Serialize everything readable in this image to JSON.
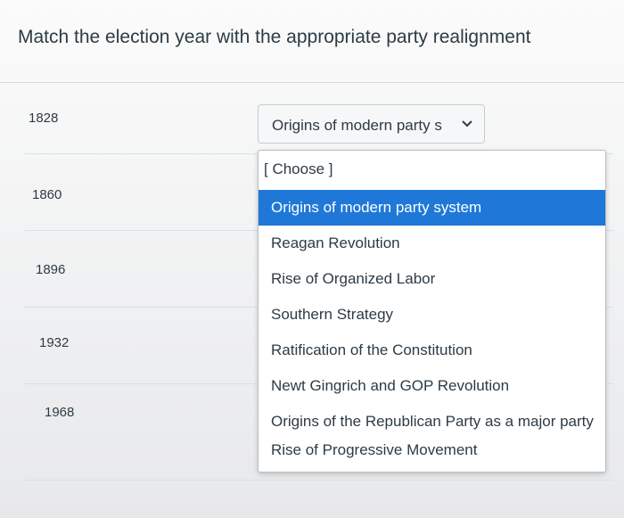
{
  "question": "Match the election year with the appropriate party realignment",
  "years": [
    "1828",
    "1860",
    "1896",
    "1932",
    "1968"
  ],
  "select": {
    "value": "Origins of modern party s"
  },
  "dropdown": {
    "options": [
      "[ Choose ]",
      "Origins of modern party system",
      "Reagan Revolution",
      "Rise of Organized Labor",
      "Southern Strategy",
      "Ratification of the Constitution",
      "Newt Gingrich and GOP Revolution",
      "Origins of the Republican Party as a major party",
      "Rise of Progressive Movement"
    ],
    "selected_index": 1
  },
  "colors": {
    "highlight": "#1f78d8",
    "text": "#2d3b45"
  }
}
